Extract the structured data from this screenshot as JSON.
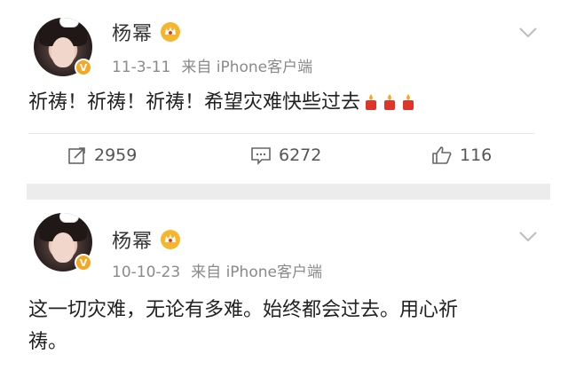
{
  "posts": [
    {
      "author": "杨幂",
      "date": "11-3-11",
      "source": "来自 iPhone客户端",
      "text": "祈祷！祈祷！祈祷！希望灾难快些过去",
      "emoji": [
        "candle-icon",
        "candle-icon",
        "candle-icon"
      ],
      "reposts": "2959",
      "comments": "6272",
      "likes": "116"
    },
    {
      "author": "杨幂",
      "date": "10-10-23",
      "source": "来自 iPhone客户端",
      "text_line1": "这一切灾难，无论有多难。始终都会过去。用心祈",
      "text_line2": "祷。"
    }
  ],
  "colors": {
    "badge": "#f5a623",
    "meta_text": "#8a8a8a",
    "separator": "#ececec"
  }
}
